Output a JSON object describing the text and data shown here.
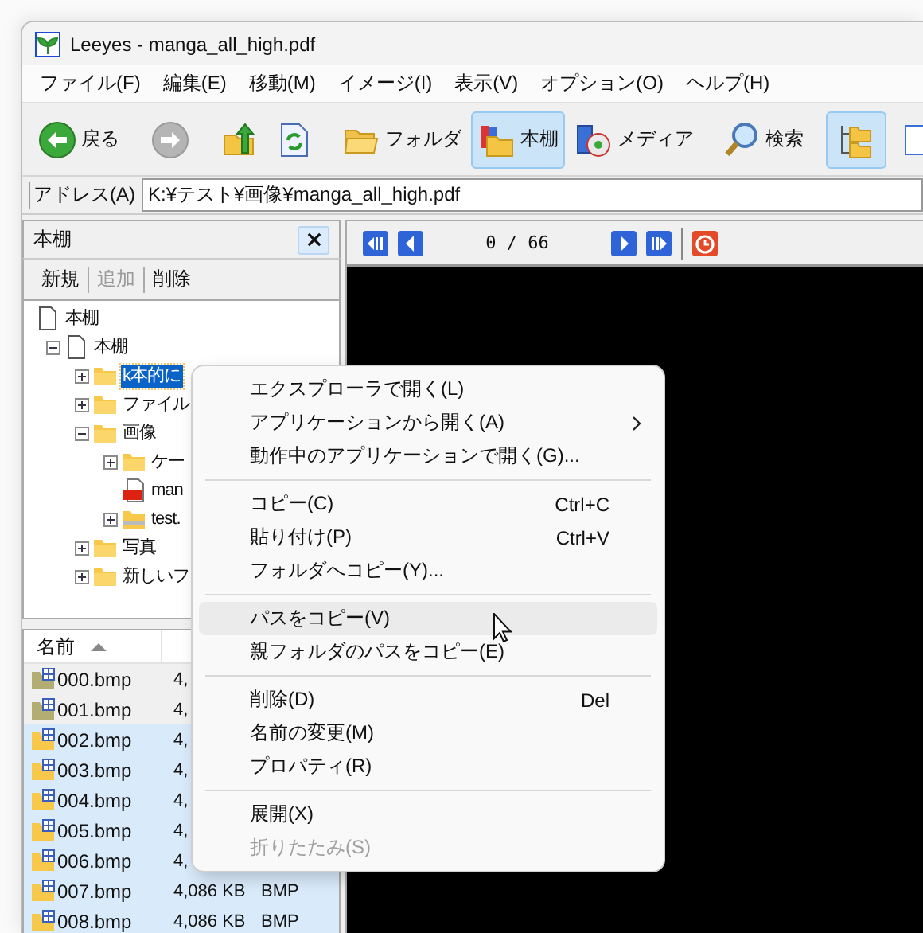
{
  "window": {
    "title": "Leeyes - manga_all_high.pdf"
  },
  "menu_bar": [
    "ファイル(F)",
    "編集(E)",
    "移動(M)",
    "イメージ(I)",
    "表示(V)",
    "オプション(O)",
    "ヘルプ(H)"
  ],
  "toolbar": {
    "back": {
      "label": "戻る",
      "disabled": false
    },
    "forward": {
      "disabled": true
    },
    "folder": {
      "label": "フォルダ",
      "selected": false
    },
    "bookshelf": {
      "label": "本棚",
      "selected": true
    },
    "media": {
      "label": "メディア",
      "selected": false
    },
    "search": {
      "label": "検索"
    },
    "view_buttons": [
      {
        "selected": true
      },
      {
        "selected": false
      }
    ]
  },
  "address_bar": {
    "label": "アドレス(A)",
    "value": "K:¥テスト¥画像¥manga_all_high.pdf"
  },
  "side_panel": {
    "title": "本棚",
    "actions": [
      {
        "label": "新規",
        "disabled": false
      },
      {
        "label": "追加",
        "disabled": true
      },
      {
        "label": "削除",
        "disabled": false
      }
    ]
  },
  "tree": [
    {
      "label": "本棚",
      "kind": "document",
      "children": [
        {
          "label": "本棚",
          "kind": "document",
          "expanded": true,
          "children": [
            {
              "label": "k本的に",
              "kind": "folder",
              "expanded": false,
              "selected": true
            },
            {
              "label": "ファイル",
              "kind": "folder",
              "expanded": false,
              "selected": false
            },
            {
              "label": "画像",
              "kind": "folder",
              "expanded": true,
              "selected": false,
              "children": [
                {
                  "label": "ケー",
                  "kind": "folder",
                  "expanded": false,
                  "selected": false
                },
                {
                  "label": "man",
                  "kind": "pdf",
                  "selected": false
                },
                {
                  "label": "test.",
                  "kind": "archive",
                  "expanded": false,
                  "selected": false
                }
              ]
            },
            {
              "label": "写真",
              "kind": "folder",
              "expanded": false,
              "selected": false
            },
            {
              "label": "新しいフ",
              "kind": "folder",
              "expanded": false,
              "selected": false
            }
          ]
        }
      ]
    }
  ],
  "file_list": {
    "columns": [
      "名前"
    ],
    "rows": [
      {
        "name": "000.bmp",
        "size": "4,",
        "type": "",
        "selected": false
      },
      {
        "name": "001.bmp",
        "size": "4,",
        "type": "",
        "selected": false
      },
      {
        "name": "002.bmp",
        "size": "4,",
        "type": "",
        "selected": true
      },
      {
        "name": "003.bmp",
        "size": "4,",
        "type": "",
        "selected": true
      },
      {
        "name": "004.bmp",
        "size": "4,",
        "type": "",
        "selected": true
      },
      {
        "name": "005.bmp",
        "size": "4,",
        "type": "",
        "selected": true
      },
      {
        "name": "006.bmp",
        "size": "4,",
        "type": "",
        "selected": true
      },
      {
        "name": "007.bmp",
        "size": "4,086 KB",
        "type": "BMP",
        "selected": true
      },
      {
        "name": "008.bmp",
        "size": "4,086 KB",
        "type": "BMP",
        "selected": true
      }
    ]
  },
  "viewer": {
    "page_counter": "0 / 66"
  },
  "context_menu": [
    {
      "kind": "item",
      "label": "エクスプローラで開く(L)",
      "disabled": false,
      "highlighted": false
    },
    {
      "kind": "item",
      "label": "アプリケーションから開く(A)",
      "submenu": true,
      "disabled": false,
      "highlighted": false
    },
    {
      "kind": "item",
      "label": "動作中のアプリケーションで開く(G)...",
      "disabled": false,
      "highlighted": false
    },
    {
      "kind": "separator"
    },
    {
      "kind": "item",
      "label": "コピー(C)",
      "shortcut": "Ctrl+C",
      "disabled": false,
      "highlighted": false
    },
    {
      "kind": "item",
      "label": "貼り付け(P)",
      "shortcut": "Ctrl+V",
      "disabled": false,
      "highlighted": false
    },
    {
      "kind": "item",
      "label": "フォルダへコピー(Y)...",
      "disabled": false,
      "highlighted": false
    },
    {
      "kind": "separator"
    },
    {
      "kind": "item",
      "label": "パスをコピー(V)",
      "disabled": false,
      "highlighted": true
    },
    {
      "kind": "item",
      "label": "親フォルダのパスをコピー(E)",
      "disabled": false,
      "highlighted": false
    },
    {
      "kind": "separator"
    },
    {
      "kind": "item",
      "label": "削除(D)",
      "shortcut": "Del",
      "disabled": false,
      "highlighted": false
    },
    {
      "kind": "item",
      "label": "名前の変更(M)",
      "disabled": false,
      "highlighted": false
    },
    {
      "kind": "item",
      "label": "プロパティ(R)",
      "disabled": false,
      "highlighted": false
    },
    {
      "kind": "separator"
    },
    {
      "kind": "item",
      "label": "展開(X)",
      "disabled": false,
      "highlighted": false
    },
    {
      "kind": "item",
      "label": "折りたたみ(S)",
      "disabled": true,
      "highlighted": false
    }
  ]
}
